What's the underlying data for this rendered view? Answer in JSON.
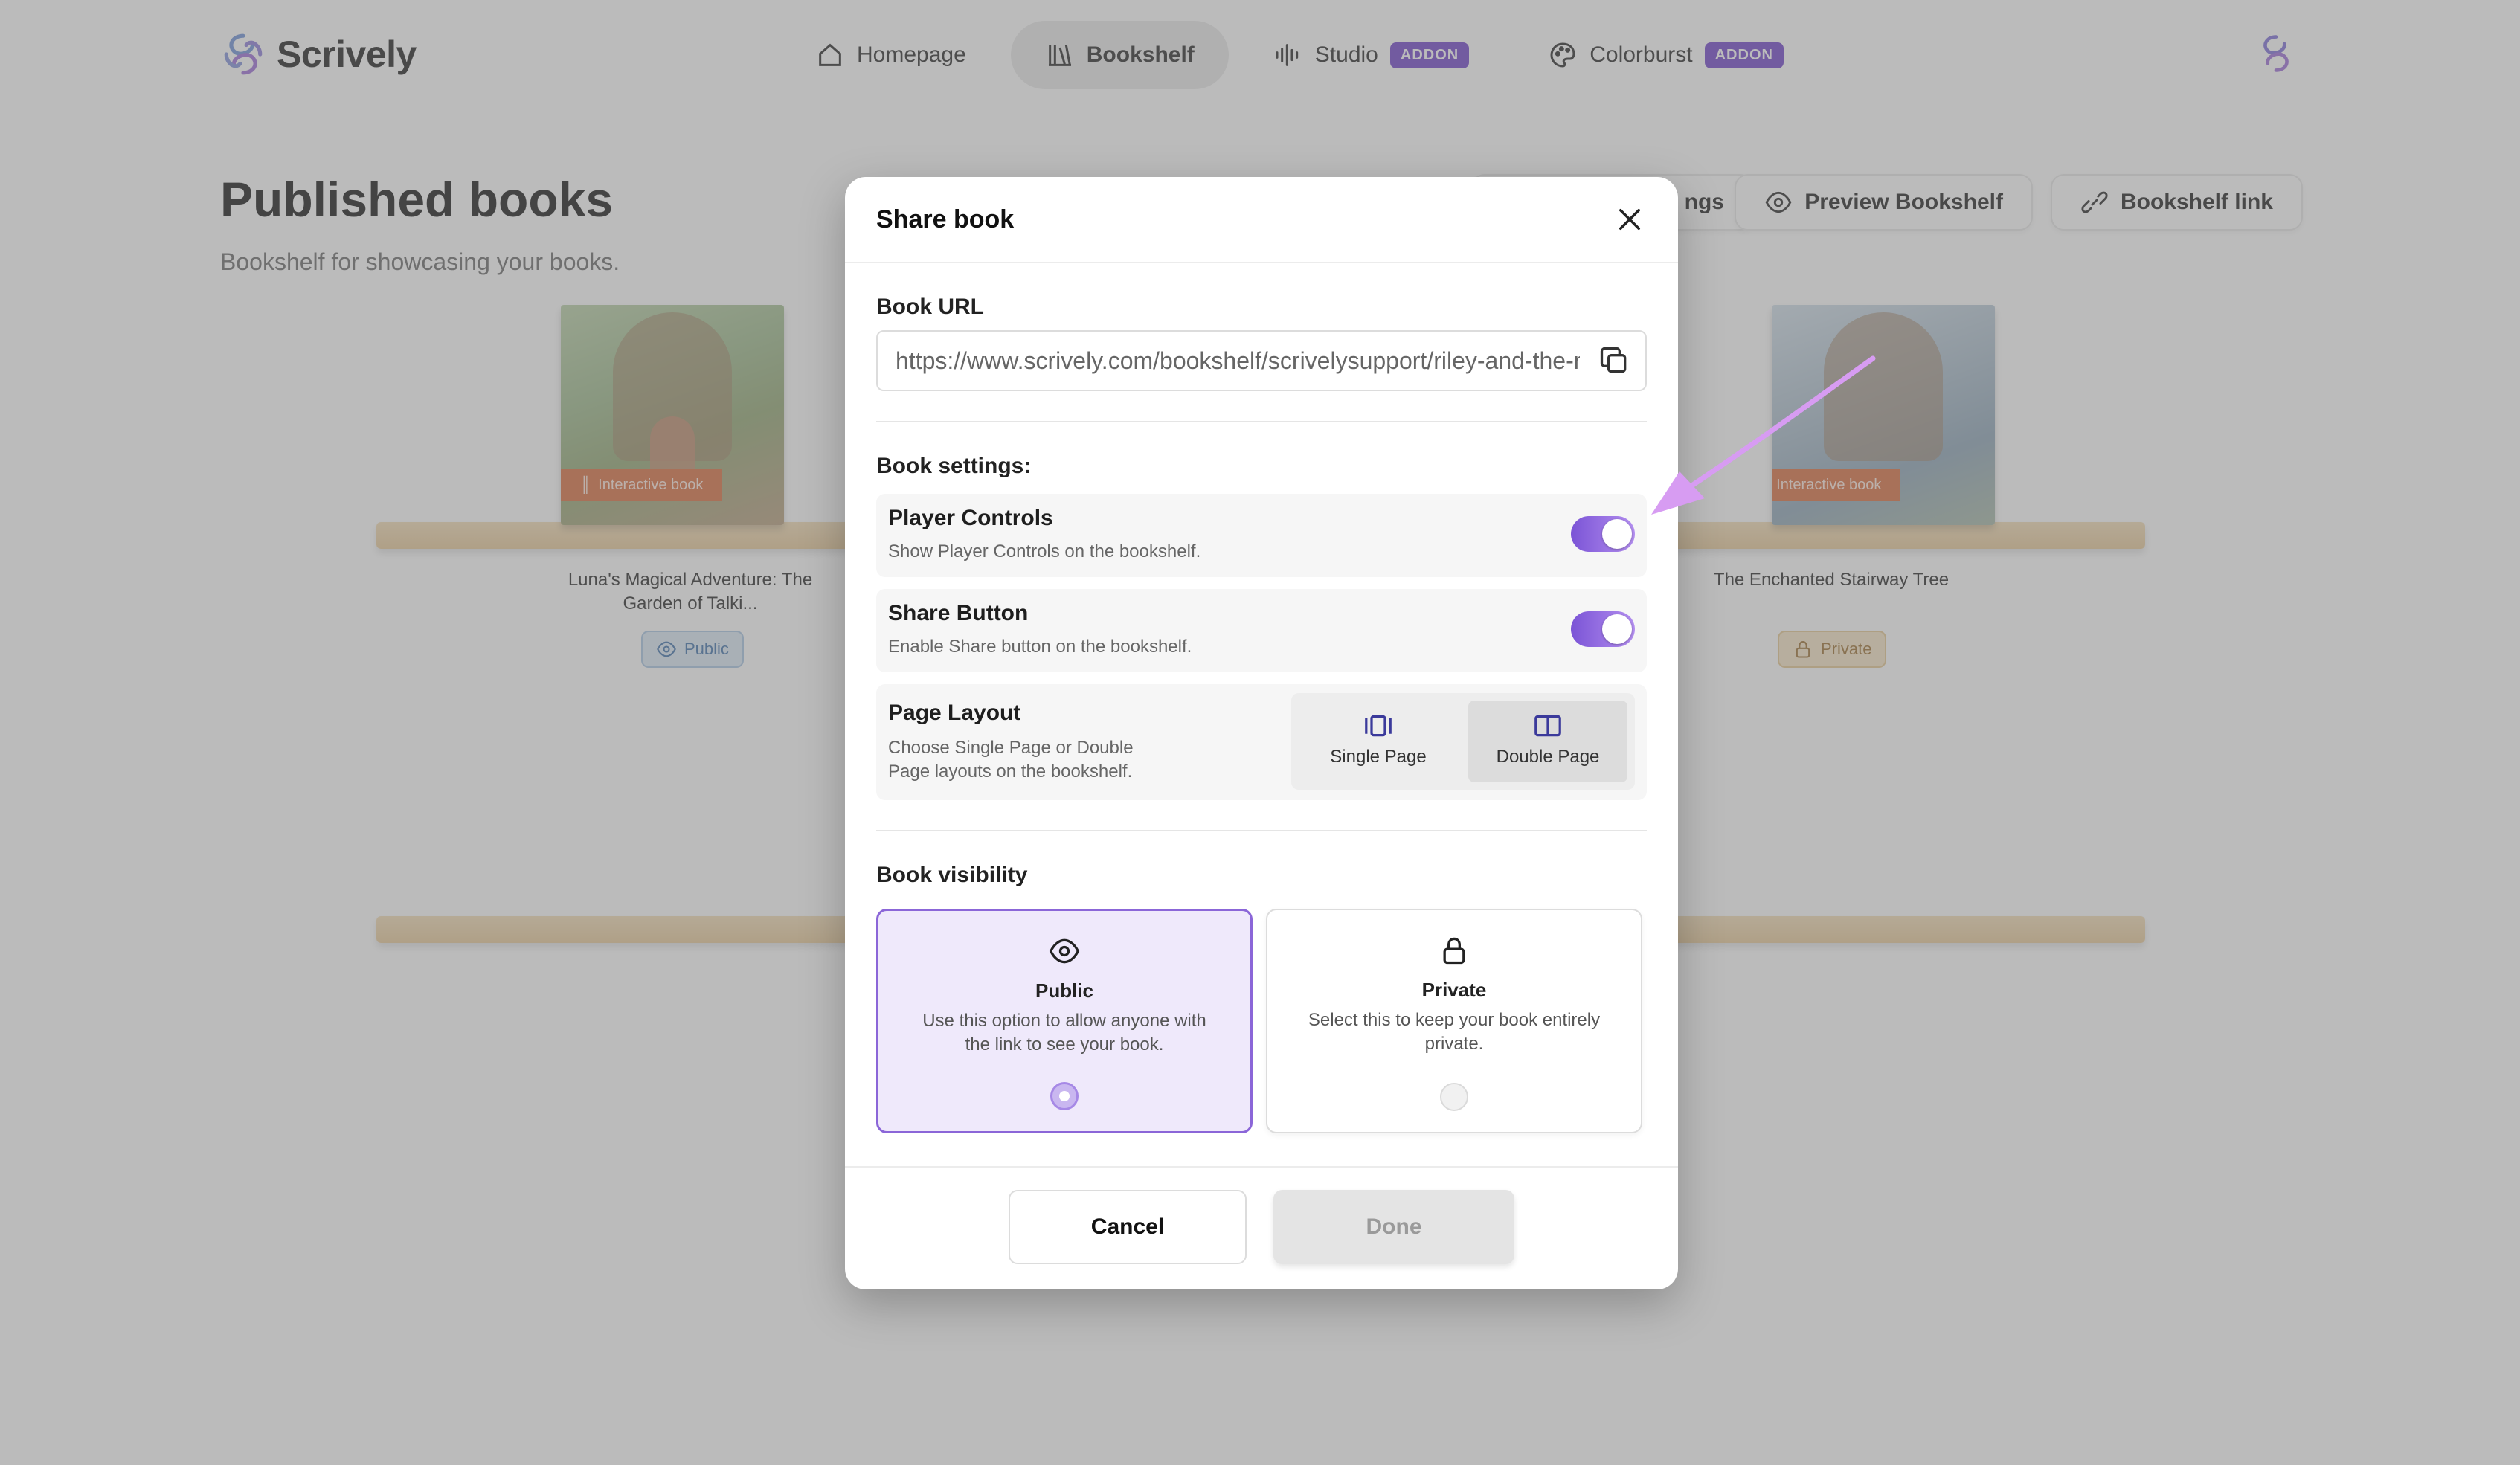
{
  "app": {
    "name": "Scrively"
  },
  "nav": {
    "items": [
      {
        "label": "Homepage",
        "icon": "home-icon"
      },
      {
        "label": "Bookshelf",
        "icon": "bookshelf-icon",
        "active": true
      },
      {
        "label": "Studio",
        "icon": "audio-waveform-icon",
        "badge": "ADDON"
      },
      {
        "label": "Colorburst",
        "icon": "palette-icon",
        "badge": "ADDON"
      }
    ]
  },
  "header": {
    "title": "Published books",
    "subtitle": "Bookshelf for showcasing your books.",
    "settings_fragment": "ngs",
    "preview_button": "Preview Bookshelf",
    "link_button": "Bookshelf link"
  },
  "books": [
    {
      "title": "Luna's Magical Adventure: The Garden of Talki...",
      "badge": "Interactive book",
      "visibility": "Public"
    },
    {
      "title": "The Enchanted Stairway Tree",
      "badge": "Interactive book",
      "visibility": "Private"
    }
  ],
  "modal": {
    "title": "Share book",
    "url_label": "Book URL",
    "url_value": "https://www.scrively.com/bookshelf/scrivelysupport/riley-and-the-magic-tree",
    "settings_label": "Book settings:",
    "player_controls": {
      "title": "Player Controls",
      "desc": "Show Player Controls on the bookshelf.",
      "on": true
    },
    "share_button": {
      "title": "Share Button",
      "desc": "Enable Share button on the bookshelf.",
      "on": true
    },
    "page_layout": {
      "title": "Page Layout",
      "desc": "Choose Single Page or Double Page layouts on the bookshelf.",
      "options": [
        "Single Page",
        "Double Page"
      ],
      "selected": "Double Page"
    },
    "visibility_label": "Book visibility",
    "public": {
      "title": "Public",
      "desc": "Use this option to allow anyone with the link to see your book."
    },
    "private": {
      "title": "Private",
      "desc": "Select this to keep your book entirely private."
    },
    "selected_visibility": "Public",
    "cancel": "Cancel",
    "done": "Done"
  },
  "colors": {
    "accent": "#8b66d8",
    "addon_badge": "#6d3fc9",
    "shelf": "#e7c896",
    "annotation_arrow": "#d79cf2"
  }
}
